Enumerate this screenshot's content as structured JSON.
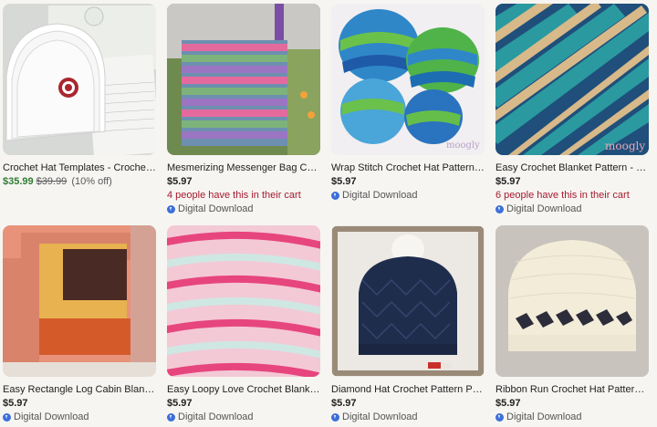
{
  "listings": [
    {
      "title": "Crochet Hat Templates - Crochet Hat T...",
      "price": "$35.99",
      "original_price": "$39.99",
      "discount": "(10% off)",
      "cart": "",
      "download": "",
      "image": "hat-templates-photo"
    },
    {
      "title": "Mesmerizing Messenger Bag Crochet ...",
      "price": "$5.97",
      "original_price": "",
      "discount": "",
      "cart": "4 people have this in their cart",
      "download": "Digital Download",
      "image": "messenger-bag-photo"
    },
    {
      "title": "Wrap Stitch Crochet Hat Pattern PDF -...",
      "price": "$5.97",
      "original_price": "",
      "discount": "",
      "cart": "",
      "download": "Digital Download",
      "image": "wrap-stitch-hats-photo"
    },
    {
      "title": "Easy Crochet Blanket Pattern - Oh My ...",
      "price": "$5.97",
      "original_price": "",
      "discount": "",
      "cart": "6 people have this in their cart",
      "download": "Digital Download",
      "image": "blanket-pattern-photo"
    },
    {
      "title": "Easy Rectangle Log Cabin Blanket Cro...",
      "price": "$5.97",
      "original_price": "",
      "discount": "",
      "cart": "",
      "download": "Digital Download",
      "image": "log-cabin-blanket-photo"
    },
    {
      "title": "Easy Loopy Love Crochet Blanket Patt...",
      "price": "$5.97",
      "original_price": "",
      "discount": "",
      "cart": "",
      "download": "Digital Download",
      "image": "loopy-love-blanket-photo"
    },
    {
      "title": "Diamond Hat Crochet Pattern PDF - B...",
      "price": "$5.97",
      "original_price": "",
      "discount": "",
      "cart": "",
      "download": "Digital Download",
      "image": "diamond-hat-photo"
    },
    {
      "title": "Ribbon Run Crochet Hat Pattern PDF - ...",
      "price": "$5.97",
      "original_price": "",
      "discount": "",
      "cart": "",
      "download": "Digital Download",
      "image": "ribbon-run-hat-photo"
    }
  ],
  "colors": {
    "sale": "#2f7d32",
    "cart_notice": "#a61a2e",
    "download_icon": "#3d6fd8"
  },
  "watermark": "moogly"
}
